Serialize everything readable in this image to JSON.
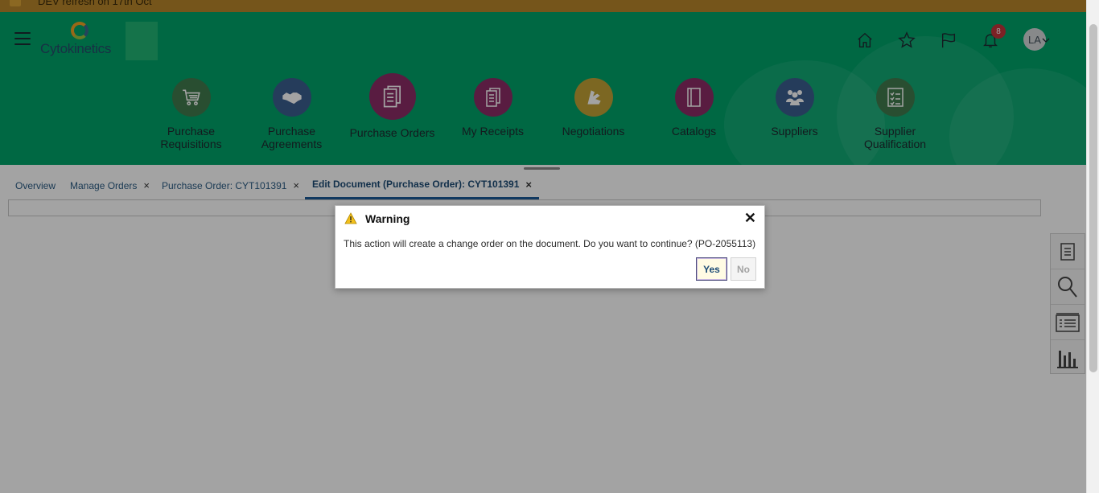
{
  "banner": {
    "text": "DEV refresh on 17th Oct"
  },
  "header": {
    "brand_name": "Cytokinetics",
    "notification_count": "8",
    "user_initials": "LA",
    "icons": [
      "home-icon",
      "favorites-star-icon",
      "watchlist-flag-icon",
      "notifications-bell-icon",
      "chevron-down-icon"
    ]
  },
  "apps": [
    {
      "label": "Purchase Requisitions",
      "icon": "shopping-cart-icon",
      "color": "#407a4e"
    },
    {
      "label": "Purchase Agreements",
      "icon": "handshake-icon",
      "color": "#3b5f8f"
    },
    {
      "label": "Purchase Orders",
      "icon": "document-stack-icon",
      "color": "#8c2d66"
    },
    {
      "label": "My Receipts",
      "icon": "receipt-icon",
      "color": "#8c2d66"
    },
    {
      "label": "Negotiations",
      "icon": "negotiation-icon",
      "color": "#c2a236"
    },
    {
      "label": "Catalogs",
      "icon": "catalog-book-icon",
      "color": "#8c2d66"
    },
    {
      "label": "Suppliers",
      "icon": "people-group-icon",
      "color": "#3b5f8f"
    },
    {
      "label": "Supplier Qualification",
      "icon": "checklist-icon",
      "color": "#407a4e"
    }
  ],
  "tabs": [
    {
      "label": "Overview",
      "closable": false,
      "active": false
    },
    {
      "label": "Manage Orders",
      "closable": true,
      "active": false
    },
    {
      "label": "Purchase Order: CYT101391",
      "closable": true,
      "active": false
    },
    {
      "label": "Edit Document (Purchase Order): CYT101391",
      "closable": true,
      "active": true
    }
  ],
  "tab_close_glyph": "×",
  "right_rail": [
    "tasks-list-icon",
    "search-icon",
    "list-view-icon",
    "bar-chart-icon"
  ],
  "dialog": {
    "title": "Warning",
    "message": "This action will create a change order on the document. Do you want to continue? (PO-2055113)",
    "yes_label": "Yes",
    "no_label": "No",
    "close_glyph": "✕"
  }
}
